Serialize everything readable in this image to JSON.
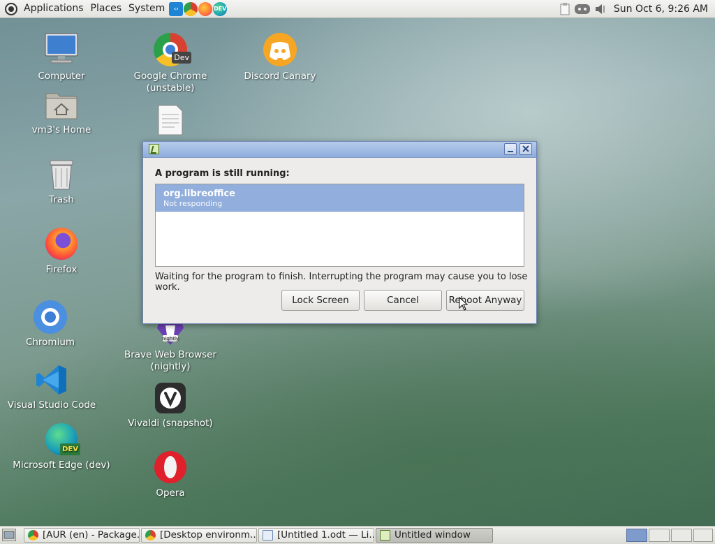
{
  "top_panel": {
    "menus": [
      "Applications",
      "Places",
      "System"
    ],
    "launchers": [
      {
        "icon": "vscode-icon",
        "color": "#1f84d3"
      },
      {
        "icon": "chrome-dev-icon",
        "color": "#d8412f"
      },
      {
        "icon": "firefox-icon",
        "color": "#ff7139"
      },
      {
        "icon": "edge-dev-icon",
        "color": "#1aa1b8"
      }
    ],
    "clock": "Sun Oct  6,  9:26 AM"
  },
  "desktop_icons": [
    {
      "label": "Computer",
      "icon": "computer-icon"
    },
    {
      "label": "vm3's Home",
      "icon": "home-folder-icon"
    },
    {
      "label": "Trash",
      "icon": "trash-icon"
    },
    {
      "label": "Firefox",
      "icon": "firefox-icon"
    },
    {
      "label": "Chromium",
      "icon": "chromium-icon"
    },
    {
      "label": "Visual Studio Code",
      "icon": "vscode-icon"
    },
    {
      "label": "Microsoft Edge (dev)",
      "icon": "edge-dev-icon"
    },
    {
      "label": "Google Chrome (unstable)",
      "icon": "chrome-dev-icon"
    },
    {
      "label": "Discord Canary",
      "icon": "discord-icon"
    },
    {
      "label": "Brave Web Browser (nightly)",
      "icon": "brave-nightly-icon"
    },
    {
      "label": "Vivaldi (snapshot)",
      "icon": "vivaldi-icon"
    },
    {
      "label": "Opera",
      "icon": "opera-icon"
    }
  ],
  "dialog": {
    "heading": "A program is still running:",
    "programs": [
      {
        "name": "org.libreoffice",
        "status": "Not responding"
      }
    ],
    "message": "Waiting for the program to finish.  Interrupting the program may cause you to lose work.",
    "buttons": {
      "lock": "Lock Screen",
      "cancel": "Cancel",
      "reboot": "Reboot Anyway"
    }
  },
  "taskbar": {
    "tasks": [
      {
        "label": "[AUR (en) - Package...",
        "icon": "chrome-icon"
      },
      {
        "label": "[Desktop environm...",
        "icon": "chrome-icon"
      },
      {
        "label": "[Untitled 1.odt — Li...",
        "icon": "writer-icon"
      },
      {
        "label": "Untitled window",
        "icon": "exit-icon"
      }
    ]
  },
  "colors": {
    "dialog_titlebar": "#9fb9e2",
    "selection": "#91aedd",
    "workspace_active": "#7f9bcb"
  }
}
